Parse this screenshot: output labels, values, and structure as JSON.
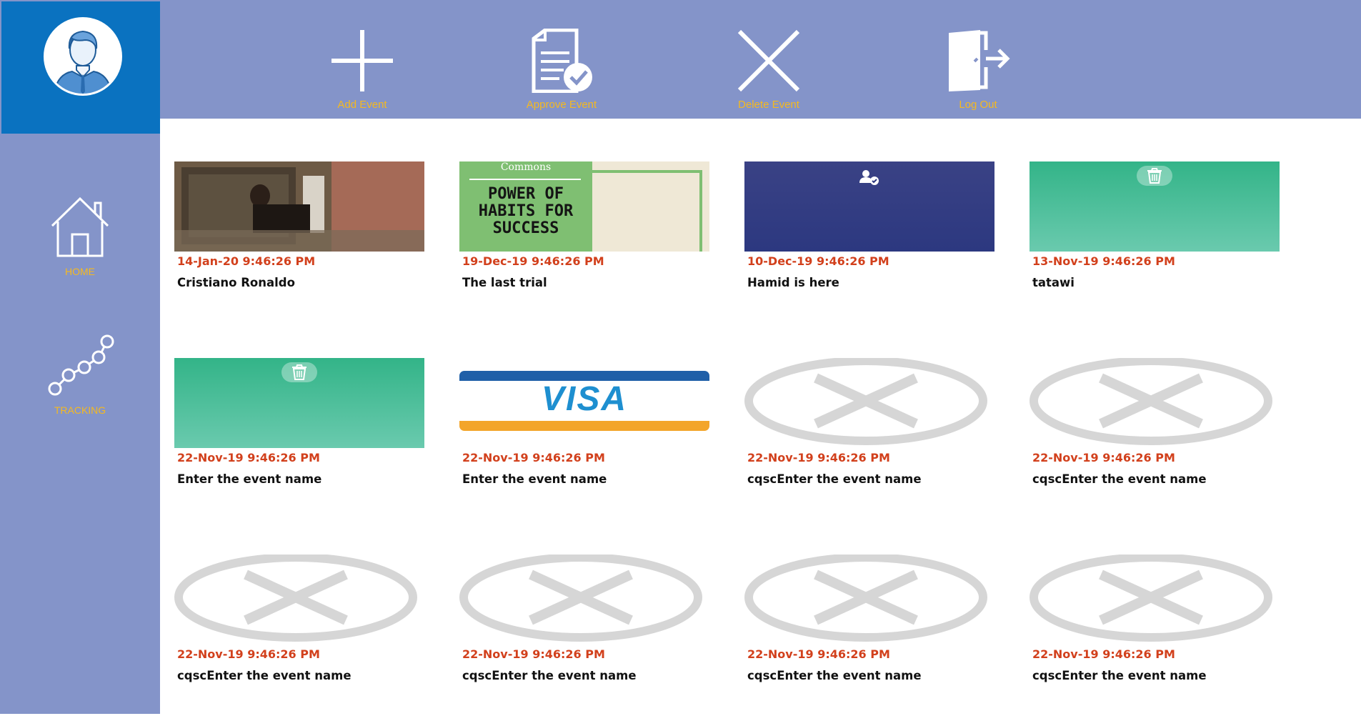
{
  "sidebar": {
    "avatar_icon": "user-avatar-icon",
    "items": [
      {
        "label": "HOME",
        "icon": "house-icon"
      },
      {
        "label": "TRACKING",
        "icon": "tracking-chain-icon"
      }
    ]
  },
  "toolbar": {
    "items": [
      {
        "label": "Add Event",
        "icon": "plus-icon"
      },
      {
        "label": "Approve Event",
        "icon": "approve-document-icon"
      },
      {
        "label": "Delete Event",
        "icon": "close-icon"
      },
      {
        "label": "Log Out",
        "icon": "logout-door-icon"
      }
    ]
  },
  "events": [
    {
      "date": "14-Jan-20 9:46:26 PM",
      "name": "Cristiano Ronaldo",
      "thumb": "photo"
    },
    {
      "date": "19-Dec-19 9:46:26 PM",
      "name": "The last trial",
      "thumb": "book-cover",
      "cover_brand": "Commons",
      "cover_title": [
        "POWER OF",
        "HABITS FOR",
        "SUCCESS"
      ]
    },
    {
      "date": "10-Dec-19 9:46:26 PM",
      "name": "Hamid is here",
      "thumb": "navy-user-check"
    },
    {
      "date": "13-Nov-19 9:46:26 PM",
      "name": "tatawi",
      "thumb": "green-trash"
    },
    {
      "date": "22-Nov-19 9:46:26 PM",
      "name": "Enter the event name",
      "thumb": "green-trash"
    },
    {
      "date": "22-Nov-19 9:46:26 PM",
      "name": "Enter the event name",
      "thumb": "visa",
      "card_brand": "VISA"
    },
    {
      "date": "22-Nov-19 9:46:26 PM",
      "name": "cqscEnter the event name",
      "thumb": "no-image"
    },
    {
      "date": "22-Nov-19 9:46:26 PM",
      "name": "cqscEnter the event name",
      "thumb": "no-image"
    },
    {
      "date": "22-Nov-19 9:46:26 PM",
      "name": "cqscEnter the event name",
      "thumb": "no-image"
    },
    {
      "date": "22-Nov-19 9:46:26 PM",
      "name": "cqscEnter the event name",
      "thumb": "no-image"
    },
    {
      "date": "22-Nov-19 9:46:26 PM",
      "name": "cqscEnter the event name",
      "thumb": "no-image"
    },
    {
      "date": "22-Nov-19 9:46:26 PM",
      "name": "cqscEnter the event name",
      "thumb": "no-image"
    }
  ],
  "colors": {
    "panel": "#8494c9",
    "avatar_panel": "#0a72c0",
    "accent_label": "#f5b91f",
    "date_text": "#d2401c"
  }
}
